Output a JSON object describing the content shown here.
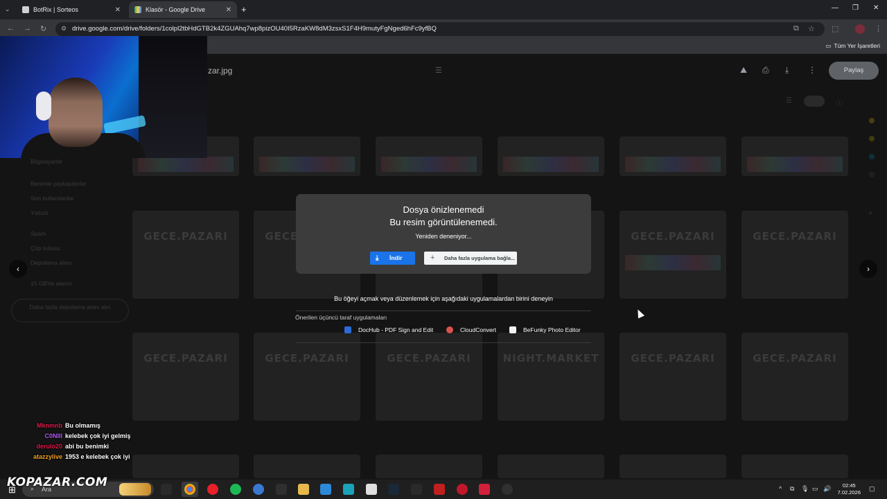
{
  "browser": {
    "tabs": [
      {
        "title": "BotRix | Sorteos",
        "active": false
      },
      {
        "title": "Klasör - Google Drive",
        "active": true
      }
    ],
    "new_tab_icon": "+",
    "url": "drive.google.com/drive/folders/1colpl2tbHdGTB2k4ZGUAhq7wp8pizOU40I5RzaKW8dM3zsxS1F4H9mutyFgNged6hFc9yfBQ",
    "bookmarks_label": "Tüm Yer İşaretleri"
  },
  "drive": {
    "file_name": "zar.jpg",
    "share_label": "Paylaş",
    "sidebar_items": [
      "Bilgisayarlar",
      "Benimle paylaşılanlar",
      "Son kullanılanlar",
      "Yıldızlı",
      "Spam",
      "Çöp kutusu",
      "Depolama alanı",
      "15 GB'lık alanın",
      "Daha fazla depolama alanı alın"
    ],
    "tile_watermarks": [
      "GECE.PAZARI",
      "GECE.PAZARI",
      "GECE.PAZARI",
      "NIGHT.MARKET",
      "GECE.PAZARI",
      "GECE.PAZARI"
    ]
  },
  "dialog": {
    "title_line1": "Dosya önizlenemedi",
    "title_line2": "Bu resim görüntülenemedi.",
    "retry_text": "Yeniden deneniyor...",
    "download_label": "İndir",
    "more_apps_label": "Daha fazla uygulama bağla..."
  },
  "apps_panel": {
    "try_text": "Bu öğeyi açmak veya düzenlemek için aşağıdaki uygulamalardan birini deneyin",
    "suggested_label": "Önerilen üçüncü taraf uygulamaları",
    "apps": [
      {
        "name": "DocHub - PDF Sign and Edit",
        "icon": "dochub-icon",
        "color": "#2b6bd6"
      },
      {
        "name": "CloudConvert",
        "icon": "cloudconvert-icon",
        "color": "#d9534f"
      },
      {
        "name": "BeFunky Photo Editor",
        "icon": "befunky-icon",
        "color": "#f2f2f2"
      }
    ]
  },
  "chat": [
    {
      "user": "Mknmnb",
      "message": "Bu olmamış",
      "color": "#e0184a"
    },
    {
      "user": "C0Nlll",
      "message": "kelebek çok iyi gelmiş",
      "color": "#b05cf0"
    },
    {
      "user": "derulo20",
      "message": "abi bu benimki",
      "color": "#e0184a"
    },
    {
      "user": "atazzylive",
      "message": "1953 e kelebek çok iyi",
      "color": "#f0a020"
    }
  ],
  "taskbar": {
    "brand": "KOPAZAR.COM",
    "search_label": "Ara",
    "time": "02:45",
    "date": "7.02.2026"
  },
  "colors": {
    "accent": "#1a73e8",
    "dialog_bg": "#3c3c3c",
    "page_dim": "#141414"
  }
}
